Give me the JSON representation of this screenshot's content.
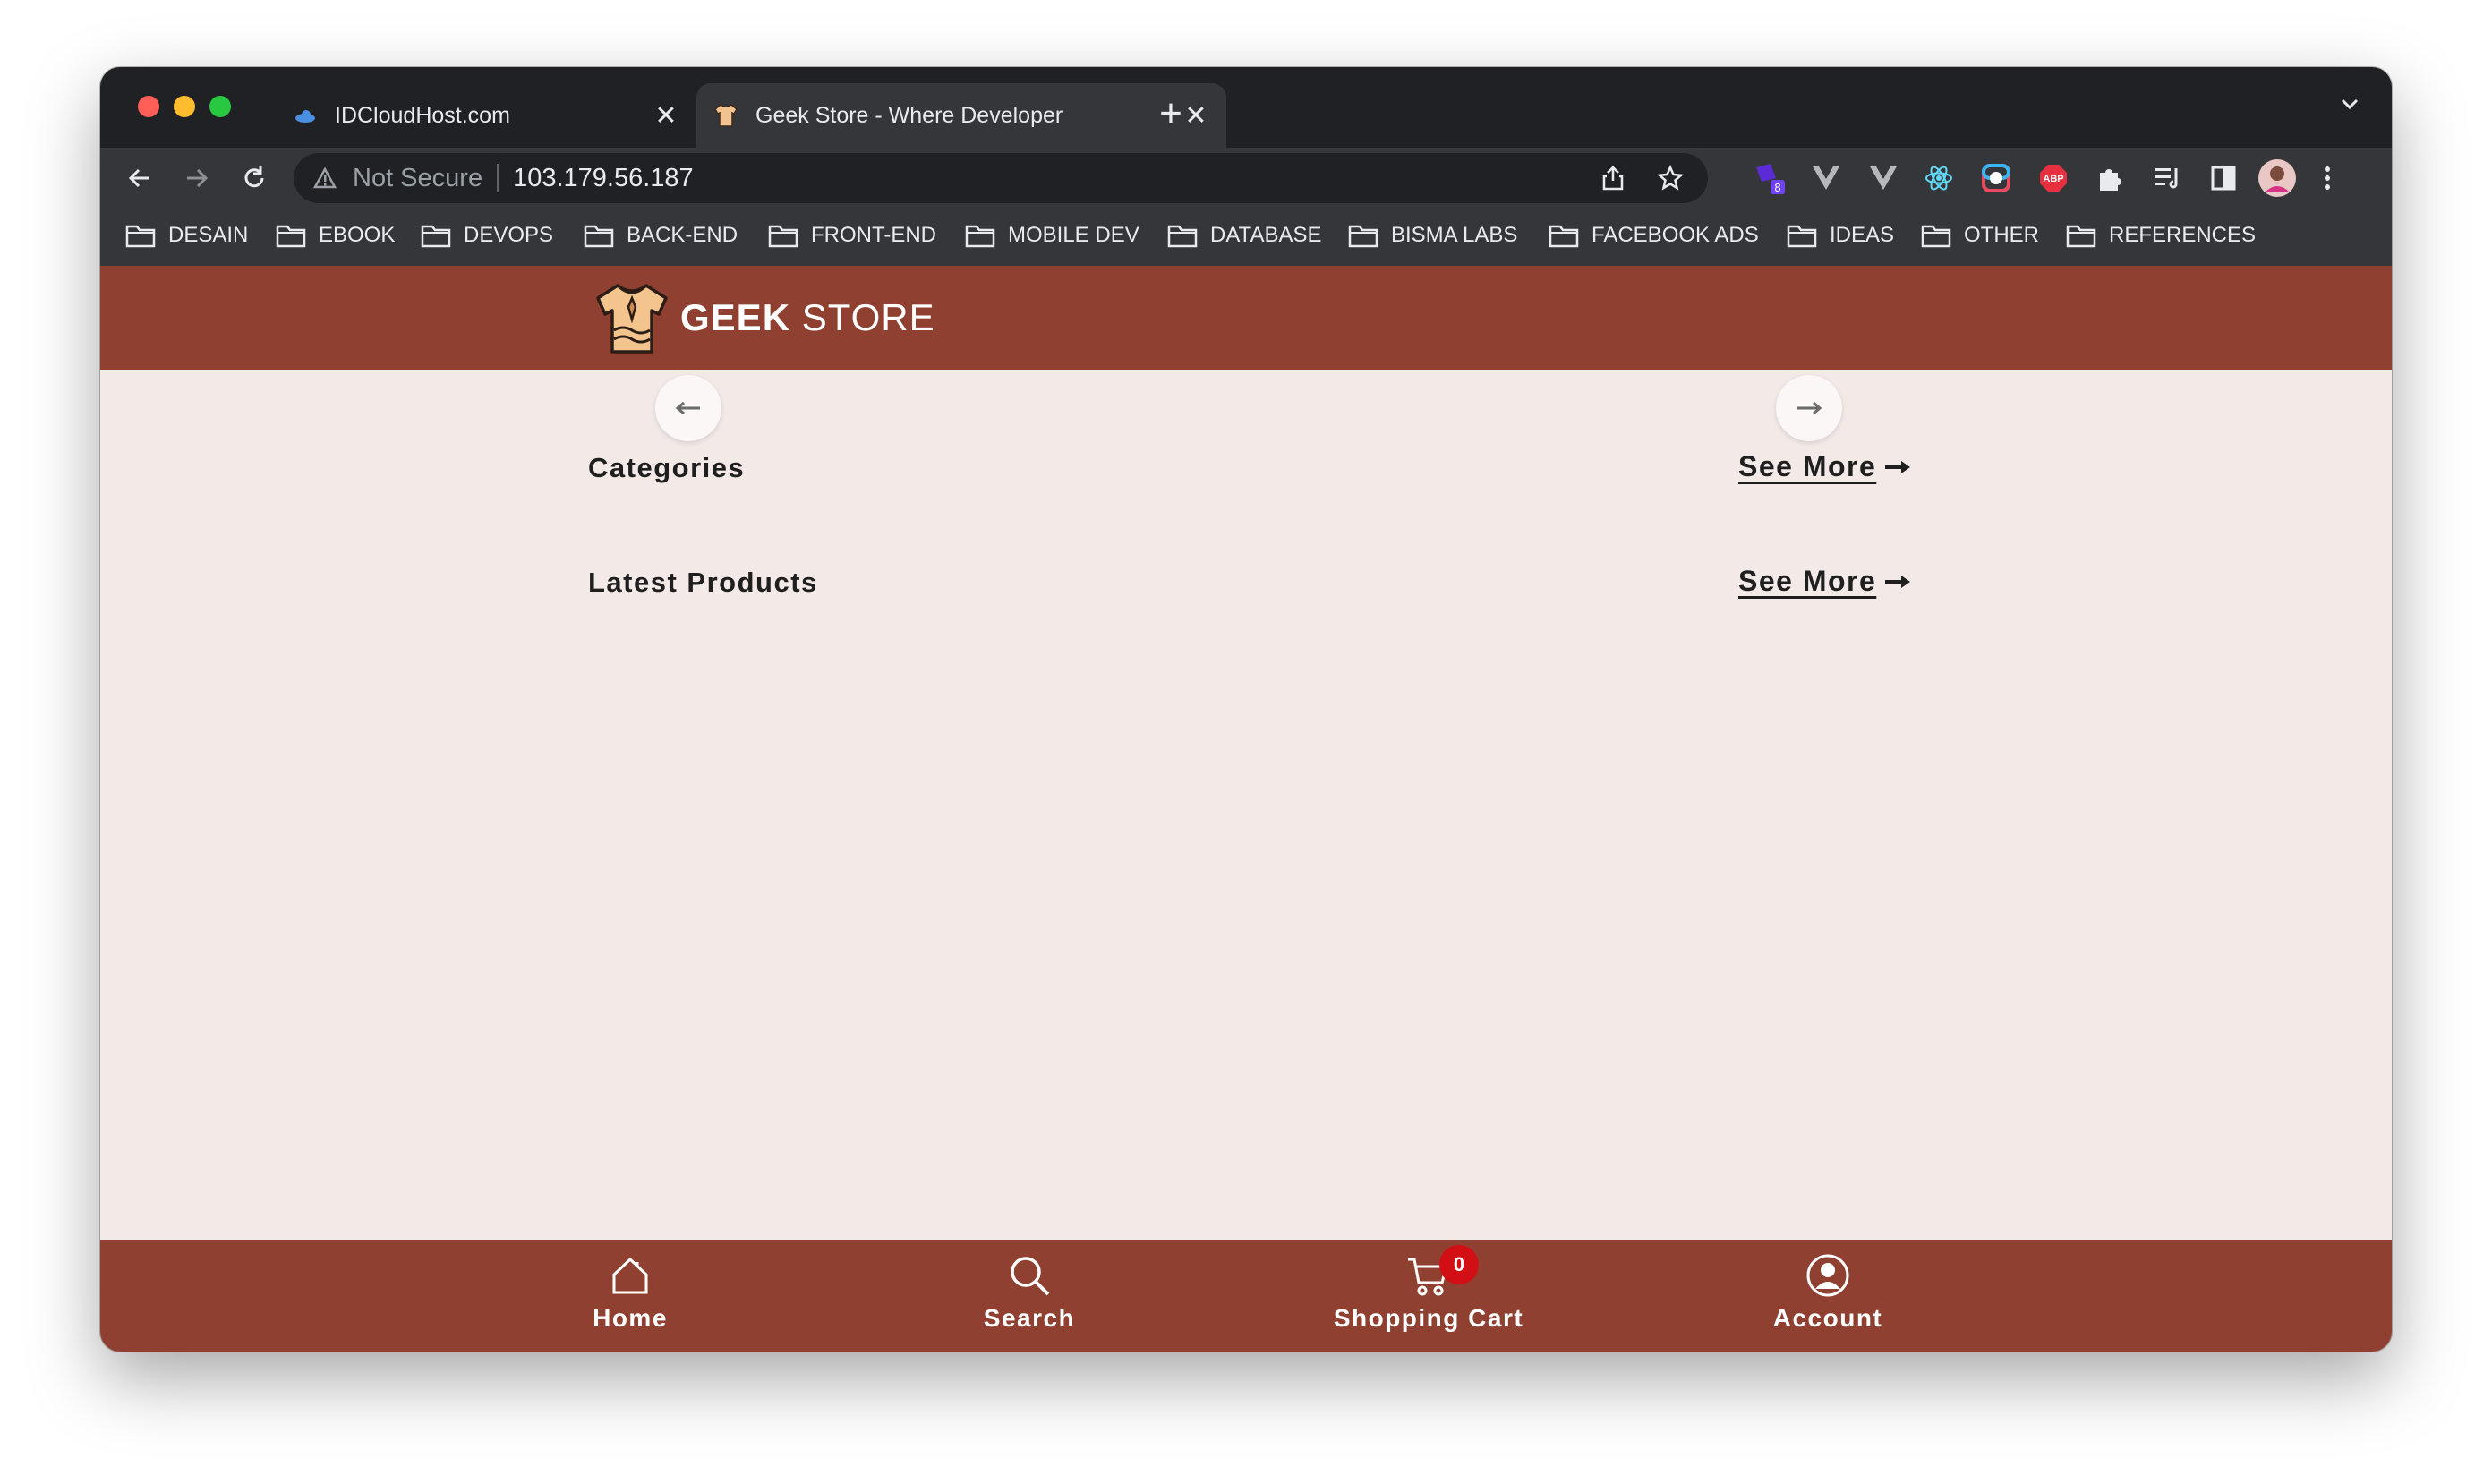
{
  "browser": {
    "tabs": [
      {
        "title": "IDCloudHost.com",
        "active": false
      },
      {
        "title": "Geek Store - Where Developer",
        "active": true
      }
    ],
    "omnibox": {
      "security_label": "Not Secure",
      "url": "103.179.56.187"
    },
    "extension_badge": "8",
    "bookmarks": [
      "DESAIN",
      "EBOOK",
      "DEVOPS",
      "BACK-END",
      "FRONT-END",
      "MOBILE DEV",
      "DATABASE",
      "BISMA LABS",
      "FACEBOOK ADS",
      "IDEAS",
      "OTHER",
      "REFERENCES"
    ]
  },
  "site": {
    "brand_bold": "GEEK",
    "brand_light": "STORE",
    "sections": [
      {
        "title": "Categories",
        "see_more": "See More"
      },
      {
        "title": "Latest Products",
        "see_more": "See More"
      }
    ],
    "bottom_nav": {
      "home": "Home",
      "search": "Search",
      "cart": "Shopping Cart",
      "cart_count": "0",
      "account": "Account"
    },
    "colors": {
      "header": "#8f4030",
      "background": "#f3eae8",
      "badge": "#d10f15"
    }
  }
}
